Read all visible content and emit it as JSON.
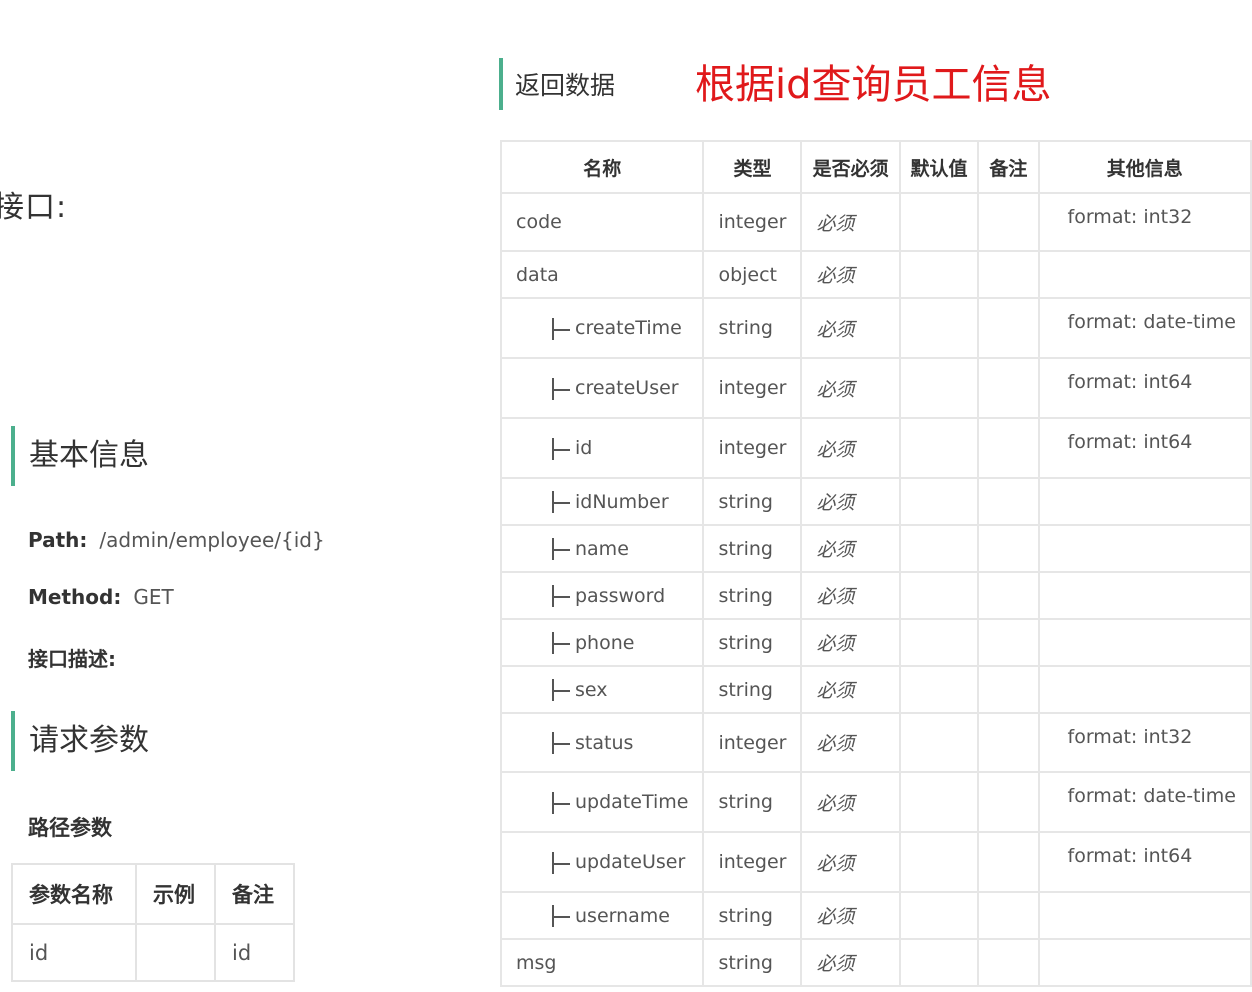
{
  "left": {
    "cut_heading": "接口:",
    "basic_title": "基本信息",
    "path_label": "Path:",
    "path_value": "/admin/employee/{id}",
    "method_label": "Method:",
    "method_value": "GET",
    "desc_label": "接口描述:",
    "request_title": "请求参数",
    "path_params_title": "路径参数",
    "params_table": {
      "headers": [
        "参数名称",
        "示例",
        "备注"
      ],
      "rows": [
        [
          "id",
          "",
          "id"
        ]
      ]
    }
  },
  "right": {
    "return_title": "返回数据",
    "red_title": "根据id查询员工信息",
    "headers": [
      "名称",
      "类型",
      "是否必须",
      "默认值",
      "备注",
      "其他信息"
    ],
    "rows": [
      {
        "name": "code",
        "child": false,
        "type": "integer",
        "required": "必须",
        "default": "",
        "note": "",
        "other": "format: int32"
      },
      {
        "name": "data",
        "child": false,
        "type": "object",
        "required": "必须",
        "default": "",
        "note": "",
        "other": ""
      },
      {
        "name": "createTime",
        "child": true,
        "type": "string",
        "required": "必须",
        "default": "",
        "note": "",
        "other": "format: date-time"
      },
      {
        "name": "createUser",
        "child": true,
        "type": "integer",
        "required": "必须",
        "default": "",
        "note": "",
        "other": "format: int64"
      },
      {
        "name": "id",
        "child": true,
        "type": "integer",
        "required": "必须",
        "default": "",
        "note": "",
        "other": "format: int64"
      },
      {
        "name": "idNumber",
        "child": true,
        "type": "string",
        "required": "必须",
        "default": "",
        "note": "",
        "other": ""
      },
      {
        "name": "name",
        "child": true,
        "type": "string",
        "required": "必须",
        "default": "",
        "note": "",
        "other": ""
      },
      {
        "name": "password",
        "child": true,
        "type": "string",
        "required": "必须",
        "default": "",
        "note": "",
        "other": ""
      },
      {
        "name": "phone",
        "child": true,
        "type": "string",
        "required": "必须",
        "default": "",
        "note": "",
        "other": ""
      },
      {
        "name": "sex",
        "child": true,
        "type": "string",
        "required": "必须",
        "default": "",
        "note": "",
        "other": ""
      },
      {
        "name": "status",
        "child": true,
        "type": "integer",
        "required": "必须",
        "default": "",
        "note": "",
        "other": "format: int32"
      },
      {
        "name": "updateTime",
        "child": true,
        "type": "string",
        "required": "必须",
        "default": "",
        "note": "",
        "other": "format: date-time"
      },
      {
        "name": "updateUser",
        "child": true,
        "type": "integer",
        "required": "必须",
        "default": "",
        "note": "",
        "other": "format: int64"
      },
      {
        "name": "username",
        "child": true,
        "type": "string",
        "required": "必须",
        "default": "",
        "note": "",
        "other": ""
      },
      {
        "name": "msg",
        "child": false,
        "type": "string",
        "required": "必须",
        "default": "",
        "note": "",
        "other": ""
      }
    ]
  },
  "colors": {
    "accent": "#4caf8d",
    "red_title": "#e0191b",
    "border": "#e6e6e6"
  }
}
